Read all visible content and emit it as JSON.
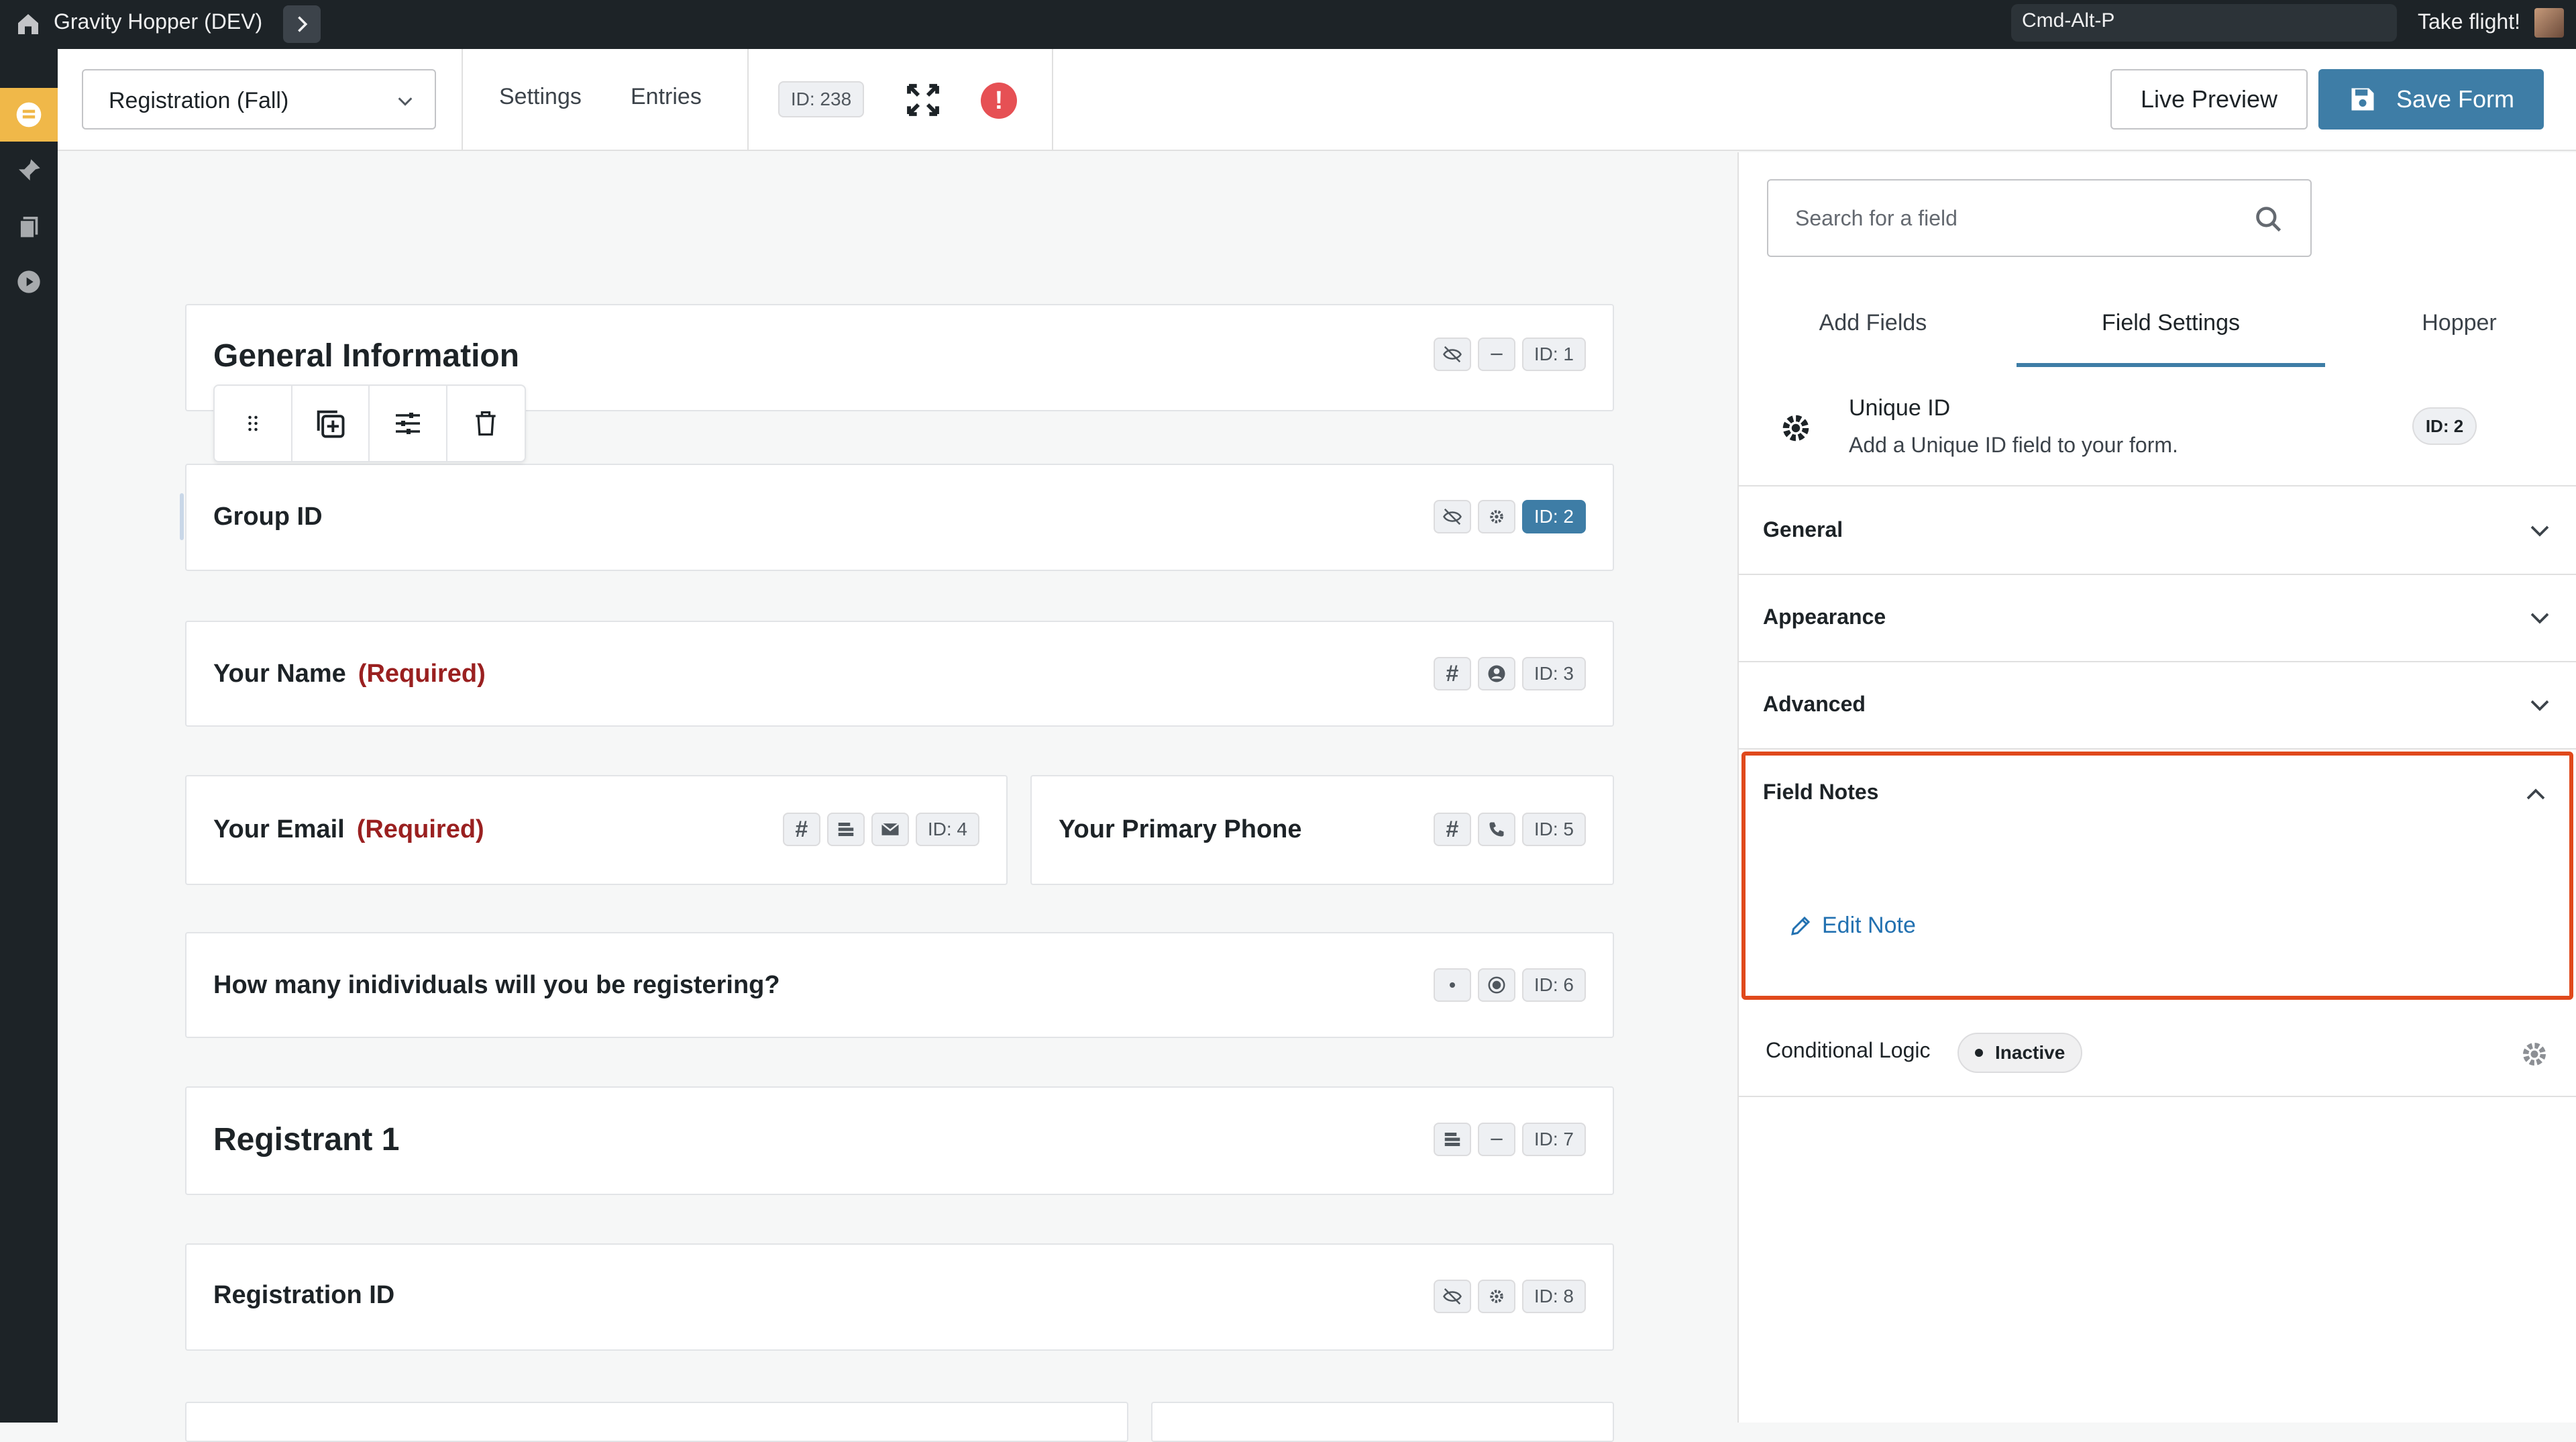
{
  "topbar": {
    "site_name": "Gravity Hopper (DEV)",
    "command_shortcut": "Cmd-Alt-P",
    "tagline": "Take flight!"
  },
  "toolbar": {
    "form_selector": "Registration (Fall)",
    "links": [
      "Settings",
      "Entries"
    ],
    "form_id": "ID: 238",
    "live_preview": "Live Preview",
    "save_form": "Save Form"
  },
  "fields": [
    {
      "label": "General Information",
      "required": "",
      "type": "section",
      "badges": [
        "eye-off-icon",
        "minus-icon"
      ],
      "id": "ID: 1"
    },
    {
      "label": "Group ID",
      "required": "",
      "type": "field",
      "badges": [
        "eye-off-icon",
        "gear-icon"
      ],
      "id": "ID: 2",
      "selected": true
    },
    {
      "label": "Your Name",
      "required": "(Required)",
      "type": "field",
      "badges": [
        "hash-icon",
        "user-icon"
      ],
      "id": "ID: 3"
    },
    {
      "label": "Your Email",
      "required": "(Required)",
      "type": "field",
      "badges": [
        "hash-icon",
        "list-icon",
        "mail-icon"
      ],
      "id": "ID: 4"
    },
    {
      "label": "Your Primary Phone",
      "required": "",
      "type": "field",
      "badges": [
        "hash-icon",
        "phone-icon"
      ],
      "id": "ID: 5"
    },
    {
      "label": "How many inidividuals will you be registering?",
      "required": "",
      "type": "field",
      "badges": [
        "dot-icon",
        "radio-icon"
      ],
      "id": "ID: 6"
    },
    {
      "label": "Registrant 1",
      "required": "",
      "type": "section",
      "badges": [
        "list-icon",
        "minus-icon"
      ],
      "id": "ID: 7"
    },
    {
      "label": "Registration ID",
      "required": "",
      "type": "field",
      "badges": [
        "eye-off-icon",
        "gear-icon"
      ],
      "id": "ID: 8"
    }
  ],
  "panel": {
    "search_placeholder": "Search for a field",
    "tabs": [
      "Add Fields",
      "Field Settings",
      "Hopper"
    ],
    "active_tab": "Field Settings",
    "field_name": "Unique ID",
    "field_description": "Add a Unique ID field to your form.",
    "field_id": "ID: 2",
    "sections": [
      "General",
      "Appearance",
      "Advanced"
    ],
    "notes_title": "Field Notes",
    "edit_note": "Edit Note",
    "conditional_logic": "Conditional Logic",
    "conditional_status": "Inactive"
  },
  "colors": {
    "accent": "#3e7da6",
    "highlight_border": "#e0491c",
    "required": "#9a2020",
    "admin_bar": "#1d2327",
    "menu_active": "#f0b849"
  }
}
